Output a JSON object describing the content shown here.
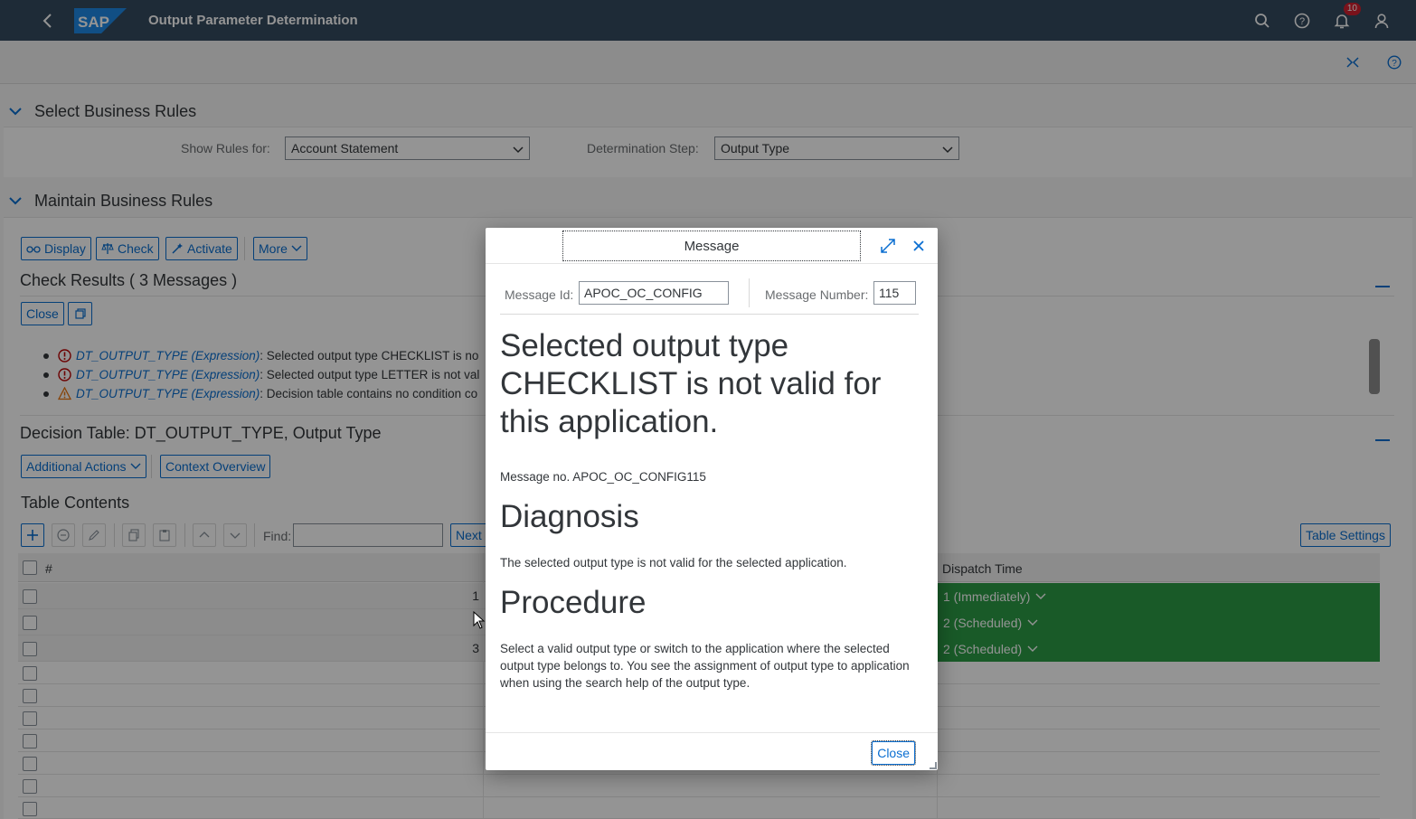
{
  "shell": {
    "title": "Output Parameter Determination",
    "notification_count": "10"
  },
  "select_rules": {
    "title": "Select Business Rules",
    "show_rules_label": "Show Rules for:",
    "show_rules_value": "Account Statement",
    "determination_label": "Determination Step:",
    "determination_value": "Output Type"
  },
  "maintain_rules": {
    "title": "Maintain Business Rules",
    "toolbar": {
      "display": "Display",
      "check": "Check",
      "activate": "Activate",
      "more": "More"
    },
    "check_results": {
      "title": "Check Results ( 3  Messages )",
      "close": "Close",
      "messages": [
        {
          "severity": "error",
          "link": "DT_OUTPUT_TYPE (Expression)",
          "text": ": Selected output type CHECKLIST is no"
        },
        {
          "severity": "error",
          "link": "DT_OUTPUT_TYPE (Expression)",
          "text": ": Selected output type LETTER is not val"
        },
        {
          "severity": "warning",
          "link": "DT_OUTPUT_TYPE (Expression)",
          "text": ": Decision table contains no condition co"
        }
      ]
    },
    "decision_table": {
      "title": "Decision Table: DT_OUTPUT_TYPE, Output Type",
      "additional_actions": "Additional Actions",
      "context_overview": "Context Overview"
    },
    "table": {
      "title": "Table Contents",
      "find_label": "Find:",
      "find_value": "",
      "next": "Next",
      "table_settings": "Table Settings",
      "columns": {
        "number": "#",
        "dispatch_time": "Dispatch Time"
      },
      "rows": [
        {
          "num": "1",
          "dispatch": "1 (Immediately)"
        },
        {
          "num": "",
          "dispatch": "2 (Scheduled)"
        },
        {
          "num": "3",
          "dispatch": "2 (Scheduled)"
        }
      ]
    }
  },
  "dialog": {
    "title": "Message",
    "message_id_label": "Message Id:",
    "message_id_value": "APOC_OC_CONFIG",
    "message_number_label": "Message Number:",
    "message_number_value": "115",
    "heading": "Selected output type CHECKLIST is not valid for this application.",
    "message_no": "Message no. APOC_OC_CONFIG115",
    "diagnosis_title": "Diagnosis",
    "diagnosis_text": "The selected output type is not valid for the selected application.",
    "procedure_title": "Procedure",
    "procedure_text": "Select a valid output type or switch to the application where the selected output type belongs to. You see the assignment of output type to application when using the search help of the output type.",
    "close": "Close"
  },
  "colors": {
    "shell_bg": "#354a5f",
    "accent": "#0a6ed1",
    "error": "#bb0000",
    "warning": "#e9730c",
    "positive_cell": "#2b9b45"
  }
}
